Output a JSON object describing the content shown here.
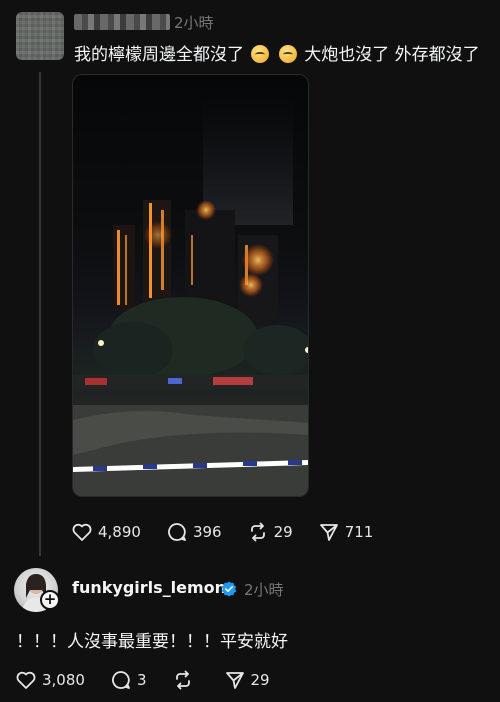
{
  "post1": {
    "time": "2小時",
    "text_part1": "我的檸檬周邊全都沒了",
    "text_part2": " 大炮也沒了 外存都沒了",
    "emoji_icons": [
      "crying-face-icon",
      "crying-face-icon"
    ],
    "likes": "4,890",
    "comments": "396",
    "reposts": "29",
    "shares": "711"
  },
  "post2": {
    "username": "funkygirls_lemon",
    "time": "2小時",
    "text": "！！！人沒事最重要！！！平安就好",
    "likes": "3,080",
    "comments": "3",
    "reposts": "",
    "shares": "29"
  },
  "colors": {
    "background": "#101010",
    "text": "#f3f5f7",
    "muted": "#777777",
    "verified": "#1d9bf0"
  }
}
